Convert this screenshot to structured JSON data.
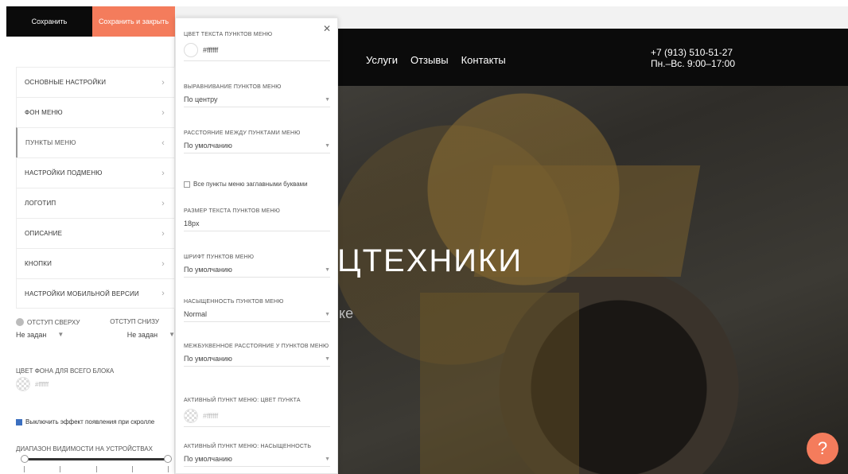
{
  "left_panel": {
    "save_label": "Сохранить",
    "save_close_label": "Сохранить и закрыть",
    "menu_items": [
      {
        "label": "ОСНОВНЫЕ НАСТРОЙКИ"
      },
      {
        "label": "ФОН МЕНЮ"
      },
      {
        "label": "ПУНКТЫ МЕНЮ"
      },
      {
        "label": "НАСТРОЙКИ ПОДМЕНЮ"
      },
      {
        "label": "ЛОГОТИП"
      },
      {
        "label": "ОПИСАНИЕ"
      },
      {
        "label": "КНОПКИ"
      },
      {
        "label": "НАСТРОЙКИ МОБИЛЬНОЙ ВЕРСИИ"
      }
    ],
    "padding_top_label": "ОТСТУП СВЕРХУ",
    "padding_bottom_label": "ОТСТУП СНИЗУ",
    "padding_top_value": "Не задан",
    "padding_bottom_value": "Не задан",
    "bg_color_label": "ЦВЕТ ФОНА ДЛЯ ВСЕГО БЛОКА",
    "bg_color_value": "#ffffff",
    "scroll_effect_label": "Выключить эффект появления при скролле",
    "visibility_label": "ДИАПАЗОН ВИДИМОСТИ НА УСТРОЙСТВАХ"
  },
  "sub_panel": {
    "text_color_label": "ЦВЕТ ТЕКСТА ПУНКТОВ МЕНЮ",
    "text_color_value": "#ffffff",
    "align_label": "ВЫРАВНИВАНИЕ ПУНКТОВ МЕНЮ",
    "align_value": "По центру",
    "spacing_label": "РАССТОЯНИЕ МЕЖДУ ПУНКТАМИ МЕНЮ",
    "spacing_value": "По умолчанию",
    "uppercase_label": "Все пункты меню заглавными буквами",
    "font_size_label": "РАЗМЕР ТЕКСТА ПУНКТОВ МЕНЮ",
    "font_size_value": "18px",
    "font_label": "ШРИФТ ПУНКТОВ МЕНЮ",
    "font_value": "По умолчанию",
    "weight_label": "НАСЫЩЕННОСТЬ ПУНКТОВ МЕНЮ",
    "weight_value": "Normal",
    "letter_spacing_label": "МЕЖБУКВЕННОЕ РАССТОЯНИЕ У ПУНКТОВ МЕНЮ",
    "letter_spacing_value": "По умолчанию",
    "active_color_label": "АКТИВНЫЙ ПУНКТ МЕНЮ: ЦВЕТ ПУНКТА",
    "active_color_value": "#ffffff",
    "active_weight_label": "АКТИВНЫЙ ПУНКТ МЕНЮ: НАСЫЩЕННОСТЬ",
    "active_weight_value": "По умолчанию"
  },
  "site": {
    "nav": [
      "Услуги",
      "Отзывы",
      "Контакты"
    ],
    "phone": "+7 (913) 510-51-27",
    "hours": "Пн.–Вс. 9:00–17:00",
    "hero_title": "ЦТЕХНИКИ",
    "hero_sub": "ке",
    "help_symbol": "?"
  },
  "colors": {
    "accent": "#f47c5c",
    "dark": "#0b0b0b"
  }
}
